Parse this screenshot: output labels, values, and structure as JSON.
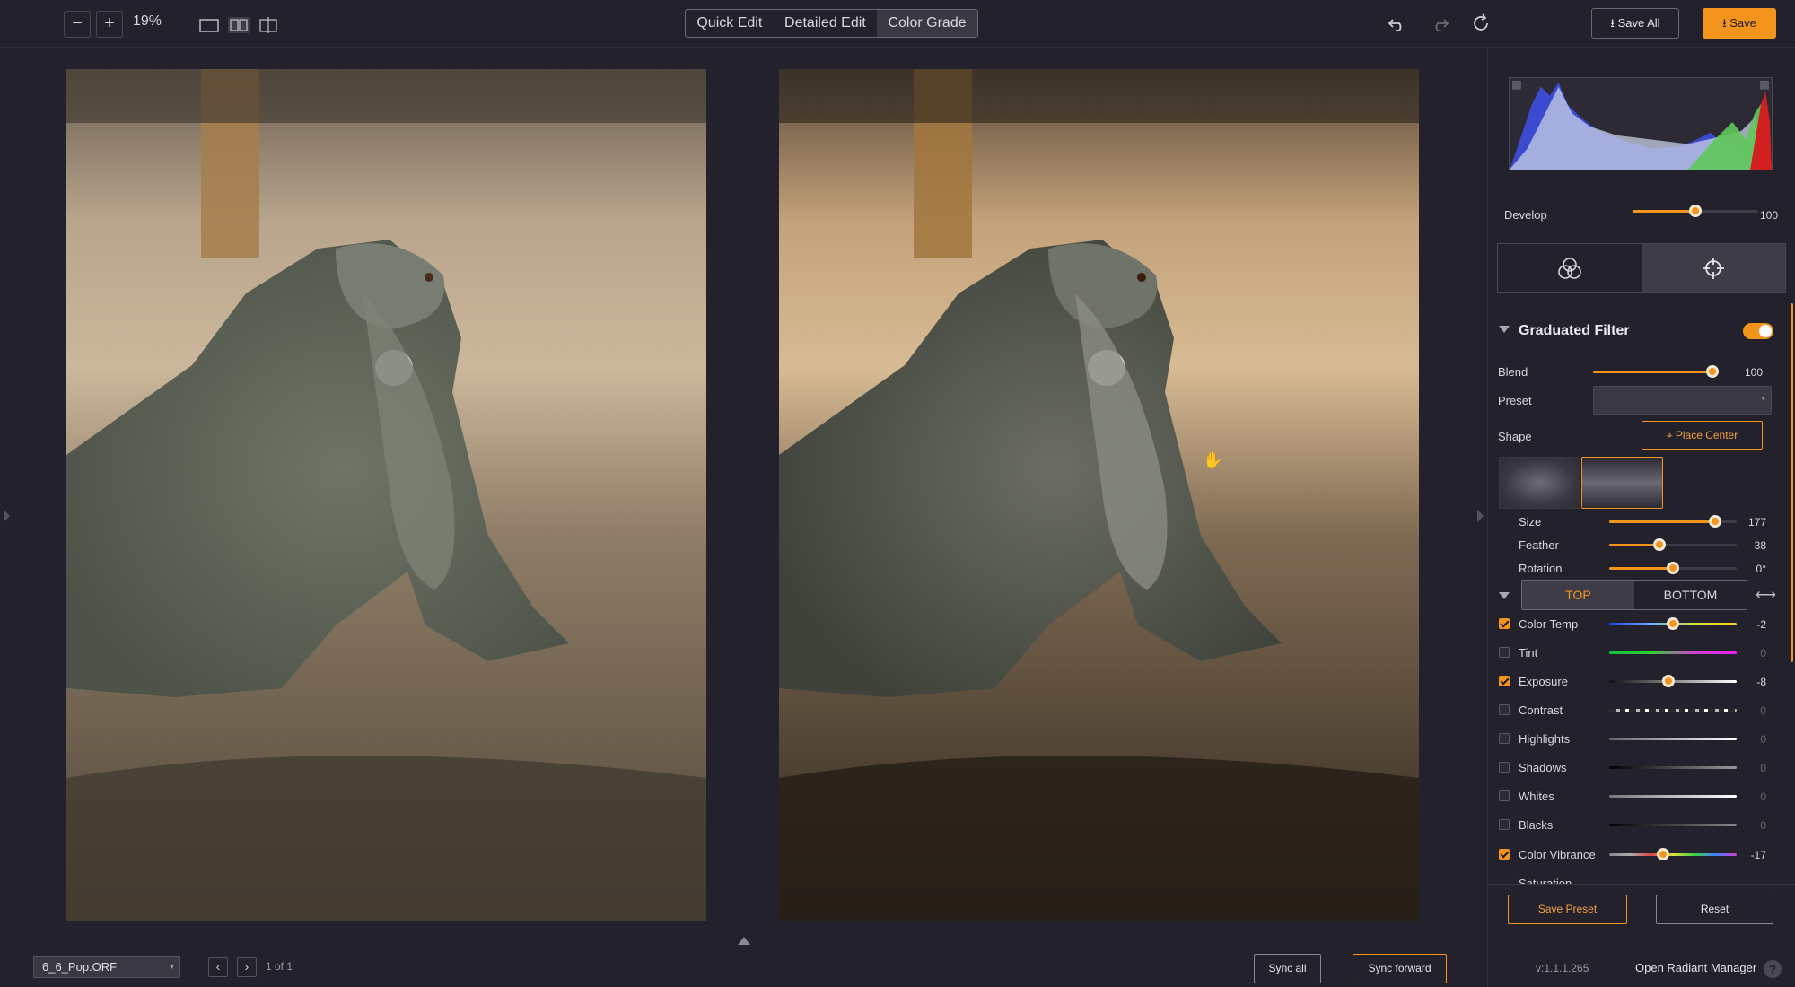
{
  "toolbar": {
    "zoom_out": "−",
    "zoom_in": "+",
    "zoom": "19%",
    "view_icons": [
      "single-view-icon",
      "split-view-icon",
      "crop-view-icon"
    ],
    "modes": [
      "Quick Edit",
      "Detailed Edit",
      "Color Grade"
    ],
    "active_mode": "Color Grade",
    "save_all": "Save All",
    "save": "Save"
  },
  "bottom": {
    "file": "6_6_Pop.ORF",
    "prev": "‹",
    "next": "›",
    "page": "1 of 1",
    "sync_all": "Sync all",
    "sync_forward": "Sync forward"
  },
  "panel": {
    "develop_label": "Develop",
    "develop_value": "100",
    "develop_level": 0.57,
    "section": "Graduated Filter",
    "enabled": true,
    "blend_label": "Blend",
    "blend_value": "100",
    "preset_label": "Preset",
    "shape_label": "Shape",
    "place_center": "Place Center",
    "size_label": "Size",
    "size_value": "177",
    "feather_label": "Feather",
    "feather_value": "38",
    "rotation_label": "Rotation",
    "rotation_value": "0°",
    "top_tab": "TOP",
    "bottom_tab": "BOTTOM",
    "adjustments": [
      {
        "label": "Color Temp",
        "value": "-2",
        "checked": true,
        "level": 0.5
      },
      {
        "label": "Tint",
        "value": "0",
        "checked": false,
        "level": null
      },
      {
        "label": "Exposure",
        "value": "-8",
        "checked": true,
        "level": 0.46
      },
      {
        "label": "Contrast",
        "value": "0",
        "checked": false,
        "level": null
      },
      {
        "label": "Highlights",
        "value": "0",
        "checked": false,
        "level": null
      },
      {
        "label": "Shadows",
        "value": "0",
        "checked": false,
        "level": null
      },
      {
        "label": "Whites",
        "value": "0",
        "checked": false,
        "level": null
      },
      {
        "label": "Blacks",
        "value": "0",
        "checked": false,
        "level": null
      },
      {
        "label": "Color Vibrance",
        "value": "-17",
        "checked": true,
        "level": 0.42
      }
    ],
    "partial_label": "Saturation",
    "save_preset": "Save Preset",
    "reset": "Reset",
    "version": "v:1.1.1.265",
    "open_manager": "Open Radiant Manager",
    "help": "?"
  },
  "colors": {
    "accent": "#f3951c",
    "background": "#23212b"
  }
}
